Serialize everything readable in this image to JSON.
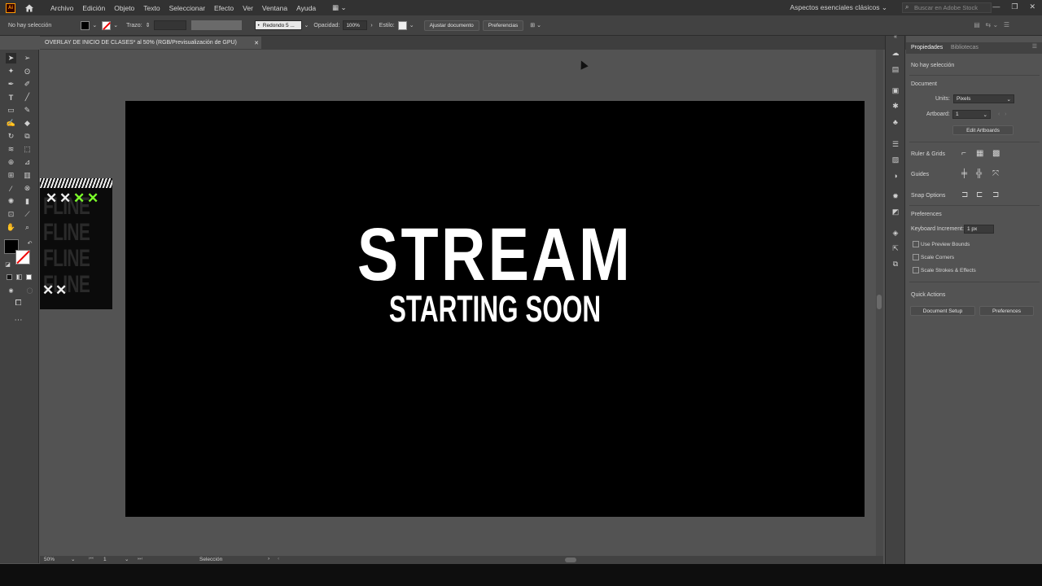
{
  "app": {
    "logo": "Ai"
  },
  "menu": [
    "Archivo",
    "Edición",
    "Objeto",
    "Texto",
    "Seleccionar",
    "Efecto",
    "Ver",
    "Ventana",
    "Ayuda"
  ],
  "workspace": "Aspectos esenciales clásicos",
  "stock_search_placeholder": "Buscar en Adobe Stock",
  "controlbar": {
    "selection": "No hay selección",
    "stroke_label": "Trazo:",
    "brush": "Redondo 5 ...",
    "opacity_label": "Opacidad:",
    "opacity_value": "100%",
    "style_label": "Estilo:",
    "fit_doc": "Ajustar documento",
    "preferences": "Preferencias"
  },
  "document_tab": "OVERLAY DE INICIO DE CLASES* al 50% (RGB/Previsualización de GPU)",
  "artboard": {
    "title": "STREAM",
    "subtitle": "STARTING SOON"
  },
  "thumb": {
    "word": "FLINE"
  },
  "status": {
    "zoom": "50%",
    "artboard_num": "1",
    "tool": "Selección"
  },
  "properties": {
    "tabs": [
      "Propiedades",
      "Bibliotecas"
    ],
    "no_selection": "No hay selección",
    "document": "Document",
    "units_label": "Units:",
    "units_value": "Pixels",
    "artboard_label": "Artboard:",
    "artboard_value": "1",
    "edit_artboards": "Edit Artboards",
    "ruler_grids": "Ruler & Grids",
    "guides": "Guides",
    "snap_options": "Snap Options",
    "preferences": "Preferences",
    "keyboard_increment_label": "Keyboard Increment:",
    "keyboard_increment_value": "1 px",
    "checks": [
      "Use Preview Bounds",
      "Scale Corners",
      "Scale Strokes & Effects"
    ],
    "quick_actions": "Quick Actions",
    "doc_setup": "Document Setup",
    "prefs_button": "Preferences"
  },
  "colors": {
    "accent_orange": "#ff9a00",
    "x_green": "#7cff2a"
  }
}
